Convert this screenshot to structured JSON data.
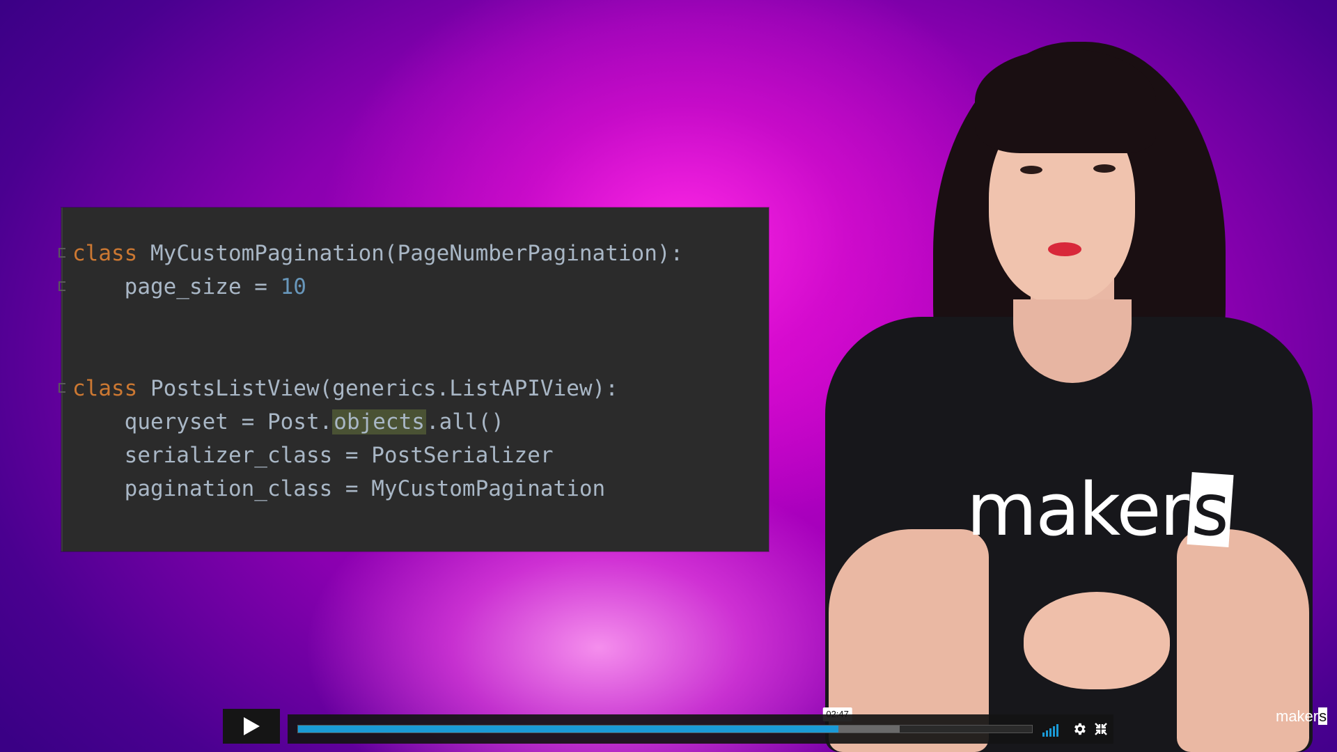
{
  "code": {
    "lines": [
      [
        {
          "t": "class",
          "c": "kw"
        },
        {
          "t": " MyCustomPagination(PageNumberPagination):",
          "c": ""
        }
      ],
      [
        {
          "t": "    page_size = ",
          "c": ""
        },
        {
          "t": "10",
          "c": "num"
        }
      ],
      [],
      [],
      [
        {
          "t": "class",
          "c": "kw"
        },
        {
          "t": " PostsListView(generics.ListAPIView):",
          "c": ""
        }
      ],
      [
        {
          "t": "    queryset = Post.",
          "c": ""
        },
        {
          "t": "objects",
          "c": "hl"
        },
        {
          "t": ".all()",
          "c": ""
        }
      ],
      [
        {
          "t": "    serializer_class = PostSerializer",
          "c": ""
        }
      ],
      [
        {
          "t": "    pagination_class = MyCustomPagination",
          "c": ""
        }
      ]
    ]
  },
  "shirt": {
    "logo_main": "maker",
    "logo_s": "s"
  },
  "player": {
    "current_time": "02:47",
    "played_fraction": 0.7345,
    "buffered_fraction": 0.818,
    "volume_bars": 5
  },
  "watermark": {
    "main": "maker",
    "s": "s"
  },
  "colors": {
    "accent": "#1a9ad6",
    "keyword": "#cc7832",
    "number": "#6897bb"
  }
}
